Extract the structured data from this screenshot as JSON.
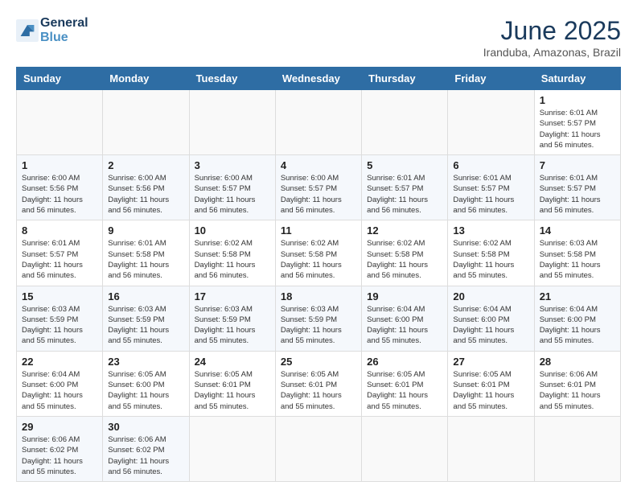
{
  "header": {
    "logo_line1": "General",
    "logo_line2": "Blue",
    "month_title": "June 2025",
    "location": "Iranduba, Amazonas, Brazil"
  },
  "calendar": {
    "days_of_week": [
      "Sunday",
      "Monday",
      "Tuesday",
      "Wednesday",
      "Thursday",
      "Friday",
      "Saturday"
    ],
    "weeks": [
      [
        {
          "day": "",
          "info": ""
        },
        {
          "day": "",
          "info": ""
        },
        {
          "day": "",
          "info": ""
        },
        {
          "day": "",
          "info": ""
        },
        {
          "day": "",
          "info": ""
        },
        {
          "day": "",
          "info": ""
        },
        {
          "day": "1",
          "info": "Sunrise: 6:01 AM\nSunset: 5:57 PM\nDaylight: 11 hours\nand 56 minutes."
        }
      ],
      [
        {
          "day": "1",
          "info": "Sunrise: 6:00 AM\nSunset: 5:56 PM\nDaylight: 11 hours\nand 56 minutes."
        },
        {
          "day": "2",
          "info": "Sunrise: 6:00 AM\nSunset: 5:56 PM\nDaylight: 11 hours\nand 56 minutes."
        },
        {
          "day": "3",
          "info": "Sunrise: 6:00 AM\nSunset: 5:57 PM\nDaylight: 11 hours\nand 56 minutes."
        },
        {
          "day": "4",
          "info": "Sunrise: 6:00 AM\nSunset: 5:57 PM\nDaylight: 11 hours\nand 56 minutes."
        },
        {
          "day": "5",
          "info": "Sunrise: 6:01 AM\nSunset: 5:57 PM\nDaylight: 11 hours\nand 56 minutes."
        },
        {
          "day": "6",
          "info": "Sunrise: 6:01 AM\nSunset: 5:57 PM\nDaylight: 11 hours\nand 56 minutes."
        },
        {
          "day": "7",
          "info": "Sunrise: 6:01 AM\nSunset: 5:57 PM\nDaylight: 11 hours\nand 56 minutes."
        }
      ],
      [
        {
          "day": "8",
          "info": "Sunrise: 6:01 AM\nSunset: 5:57 PM\nDaylight: 11 hours\nand 56 minutes."
        },
        {
          "day": "9",
          "info": "Sunrise: 6:01 AM\nSunset: 5:58 PM\nDaylight: 11 hours\nand 56 minutes."
        },
        {
          "day": "10",
          "info": "Sunrise: 6:02 AM\nSunset: 5:58 PM\nDaylight: 11 hours\nand 56 minutes."
        },
        {
          "day": "11",
          "info": "Sunrise: 6:02 AM\nSunset: 5:58 PM\nDaylight: 11 hours\nand 56 minutes."
        },
        {
          "day": "12",
          "info": "Sunrise: 6:02 AM\nSunset: 5:58 PM\nDaylight: 11 hours\nand 56 minutes."
        },
        {
          "day": "13",
          "info": "Sunrise: 6:02 AM\nSunset: 5:58 PM\nDaylight: 11 hours\nand 55 minutes."
        },
        {
          "day": "14",
          "info": "Sunrise: 6:03 AM\nSunset: 5:58 PM\nDaylight: 11 hours\nand 55 minutes."
        }
      ],
      [
        {
          "day": "15",
          "info": "Sunrise: 6:03 AM\nSunset: 5:59 PM\nDaylight: 11 hours\nand 55 minutes."
        },
        {
          "day": "16",
          "info": "Sunrise: 6:03 AM\nSunset: 5:59 PM\nDaylight: 11 hours\nand 55 minutes."
        },
        {
          "day": "17",
          "info": "Sunrise: 6:03 AM\nSunset: 5:59 PM\nDaylight: 11 hours\nand 55 minutes."
        },
        {
          "day": "18",
          "info": "Sunrise: 6:03 AM\nSunset: 5:59 PM\nDaylight: 11 hours\nand 55 minutes."
        },
        {
          "day": "19",
          "info": "Sunrise: 6:04 AM\nSunset: 6:00 PM\nDaylight: 11 hours\nand 55 minutes."
        },
        {
          "day": "20",
          "info": "Sunrise: 6:04 AM\nSunset: 6:00 PM\nDaylight: 11 hours\nand 55 minutes."
        },
        {
          "day": "21",
          "info": "Sunrise: 6:04 AM\nSunset: 6:00 PM\nDaylight: 11 hours\nand 55 minutes."
        }
      ],
      [
        {
          "day": "22",
          "info": "Sunrise: 6:04 AM\nSunset: 6:00 PM\nDaylight: 11 hours\nand 55 minutes."
        },
        {
          "day": "23",
          "info": "Sunrise: 6:05 AM\nSunset: 6:00 PM\nDaylight: 11 hours\nand 55 minutes."
        },
        {
          "day": "24",
          "info": "Sunrise: 6:05 AM\nSunset: 6:01 PM\nDaylight: 11 hours\nand 55 minutes."
        },
        {
          "day": "25",
          "info": "Sunrise: 6:05 AM\nSunset: 6:01 PM\nDaylight: 11 hours\nand 55 minutes."
        },
        {
          "day": "26",
          "info": "Sunrise: 6:05 AM\nSunset: 6:01 PM\nDaylight: 11 hours\nand 55 minutes."
        },
        {
          "day": "27",
          "info": "Sunrise: 6:05 AM\nSunset: 6:01 PM\nDaylight: 11 hours\nand 55 minutes."
        },
        {
          "day": "28",
          "info": "Sunrise: 6:06 AM\nSunset: 6:01 PM\nDaylight: 11 hours\nand 55 minutes."
        }
      ],
      [
        {
          "day": "29",
          "info": "Sunrise: 6:06 AM\nSunset: 6:02 PM\nDaylight: 11 hours\nand 55 minutes."
        },
        {
          "day": "30",
          "info": "Sunrise: 6:06 AM\nSunset: 6:02 PM\nDaylight: 11 hours\nand 56 minutes."
        },
        {
          "day": "",
          "info": ""
        },
        {
          "day": "",
          "info": ""
        },
        {
          "day": "",
          "info": ""
        },
        {
          "day": "",
          "info": ""
        },
        {
          "day": "",
          "info": ""
        }
      ]
    ]
  }
}
